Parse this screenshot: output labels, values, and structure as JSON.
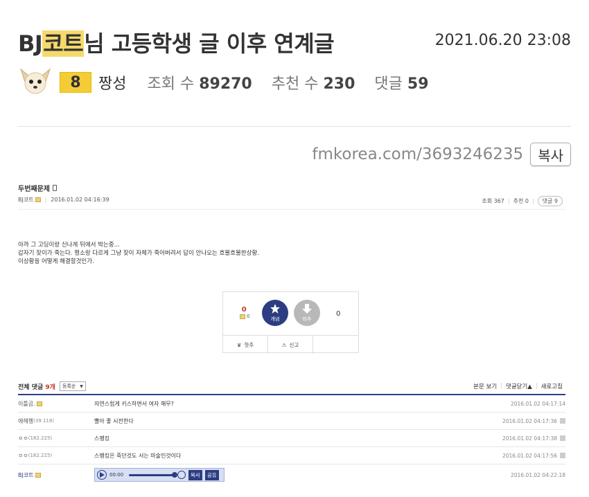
{
  "post": {
    "title_prefix": "BJ",
    "title_highlight": "코트",
    "title_suffix": "님 고등학생 글 이후 연계글",
    "date": "2021.06.20 23:08",
    "level": "8",
    "nickname": "짱성",
    "views_label": "조회 수",
    "views": "89270",
    "recommend_label": "추천 수",
    "recommend": "230",
    "comments_label": "댓글",
    "comments": "59"
  },
  "share": {
    "url": "fmkorea.com/3693246235",
    "copy_label": "복사"
  },
  "embed": {
    "title": "두번째문제",
    "author": "BJ코트",
    "datetime": "2016.01.02 04:16:39",
    "views": "조회 367",
    "recommend": "추천 0",
    "comments": "댓글 9",
    "body": [
      "아까 그 고딩이랑 신나게 뒤에서 박는중...",
      "갑자기 잦이가 죽는다. 평소랑 다르게 그냥 잦이 자체가 죽어버려서 답이 안나오는 흐물흐물한상황.",
      "이상황을 어떻게 해결할것인가."
    ],
    "vote": {
      "up_count": "0",
      "up_small": "0",
      "up_label": "개념",
      "down_label": "비추",
      "down_count": "0",
      "scrap_label": "핫추",
      "report_label": "신고"
    },
    "comment_header": {
      "all_label": "전체 댓글",
      "all_count": "9개",
      "sort": "등록순",
      "view_body": "본문 보기",
      "fold": "댓글닫기",
      "refresh": "새로고침"
    },
    "comment_rows": [
      {
        "author": "이틀곰.",
        "ip": "",
        "text": "자연스럽게 키스하면서 여자 해무?",
        "time": "2016.01.02 04:17:14"
      },
      {
        "author": "에헤헹",
        "ip": "(39.118)",
        "text": "빨아 좋 시전한다",
        "time": "2016.01.02 04:17:36"
      },
      {
        "author": "ㅇㅇ",
        "ip": "(182.225)",
        "text": "스펭킹",
        "time": "2016.01.02 04:17:38"
      },
      {
        "author": "ㅇㅇ",
        "ip": "(182.225)",
        "text": "스펭킹은 죽던것도 서는 마술인것이다",
        "time": "2016.01.02 04:17:56"
      }
    ],
    "last_row": {
      "author": "BJ코트",
      "player_time": "00:00",
      "copy": "복사",
      "share": "공유",
      "time": "2016.01.02 04:22:18"
    }
  },
  "colors": {
    "highlight": "#f6d96b",
    "level_badge": "#f4cc38",
    "accent_navy": "#2c3d82",
    "vote_red": "#c0392b"
  },
  "icons": [
    "chihuahua-avatar-icon",
    "mobile-icon",
    "level-icon",
    "star-up-icon",
    "arrow-down-icon",
    "crown-icon",
    "siren-icon",
    "play-icon",
    "volume-icon"
  ]
}
